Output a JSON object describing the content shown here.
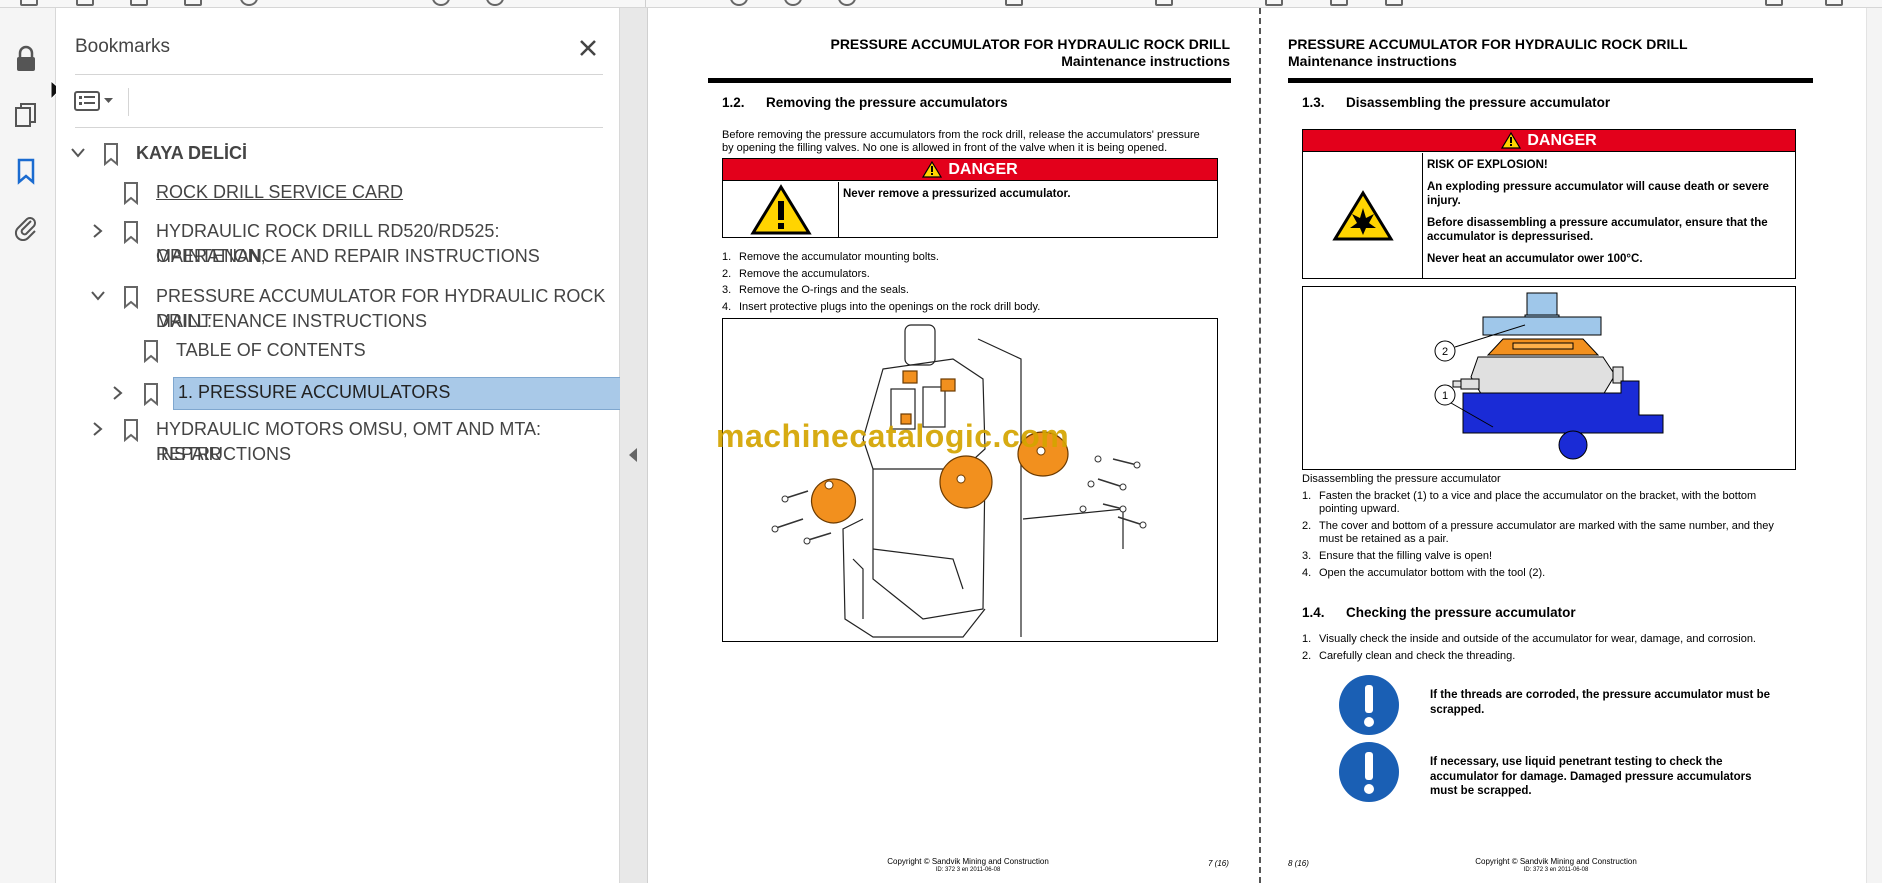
{
  "panel": {
    "title": "Bookmarks"
  },
  "bookmarks": [
    {
      "label": "KAYA DELİCİ",
      "level": 0,
      "expanded": true
    },
    {
      "label": "ROCK DRILL SERVICE CARD",
      "level": 1
    },
    {
      "label_line1": "HYDRAULIC ROCK DRILL RD520/RD525: OPERATION,",
      "label_line2": "MAINTENANCE AND REPAIR INSTRUCTIONS",
      "level": 1,
      "expanded": false
    },
    {
      "label_line1": "PRESSURE ACCUMULATOR FOR HYDRAULIC ROCK DRILL:",
      "label_line2": "MAINTENANCE INSTRUCTIONS",
      "level": 1,
      "expanded": true
    },
    {
      "label": "TABLE OF CONTENTS",
      "level": 2
    },
    {
      "label": "1. PRESSURE ACCUMULATORS",
      "level": 2,
      "selected": true,
      "expanded": false
    },
    {
      "label_line1": "HYDRAULIC MOTORS OMSU, OMT AND MTA: REPAIR",
      "label_line2": "INSTRUCTIONS",
      "level": 1,
      "expanded": false
    }
  ],
  "colors": {
    "selection": "#a9c9e8",
    "danger_red": "#e3001b",
    "accent_blue": "#1a6bd0",
    "note_blue": "#1a5fb4",
    "accumulator_orange": "#f2901e",
    "watermark": "#d4a400"
  },
  "watermark": "machinecatalogic.com",
  "page_left": {
    "header_line1": "PRESSURE ACCUMULATOR FOR HYDRAULIC ROCK DRILL",
    "header_line2": "Maintenance instructions",
    "section_num": "1.2.",
    "section_title": "Removing the pressure accumulators",
    "intro_line1": "Before removing the pressure accumulators from the rock drill, release the accumulators' pressure",
    "intro_line2": "by opening the filling valves. No one is allowed in front of the valve when it is being opened.",
    "danger_label": "DANGER",
    "danger_text": "Never remove a pressurized accumulator.",
    "steps": [
      "Remove the accumulator mounting bolts.",
      "Remove the accumulators.",
      "Remove the O-rings and the seals.",
      "Insert protective plugs into the openings on the rock drill body."
    ],
    "footer_line1": "Copyright © Sandvik Mining and Construction",
    "footer_line2": "ID: 372 3 en 2011-06-08",
    "page_number": "7 (16)"
  },
  "page_right": {
    "header_line1": "PRESSURE ACCUMULATOR FOR HYDRAULIC ROCK DRILL",
    "header_line2": "Maintenance instructions",
    "section_num": "1.3.",
    "section_title": "Disassembling the pressure accumulator",
    "danger_label": "DANGER",
    "danger_lines": [
      "RISK OF EXPLOSION!",
      "An exploding pressure accumulator will cause death or severe injury.",
      "Before disassembling a pressure accumulator, ensure that the accumulator is depressurised.",
      "Never heat an accumulator ower 100°C."
    ],
    "figure_callout_1": "1",
    "figure_callout_2": "2",
    "figure_caption": "Disassembling the pressure accumulator",
    "steps": [
      "Fasten the bracket (1) to a vice and place the accumulator on the bracket, with the bottom pointing upward.",
      "The cover and bottom of a pressure accumulator are marked with the same number, and they must be retained as a pair.",
      "Ensure that the filling valve is open!",
      "Open the accumulator bottom with the tool (2)."
    ],
    "section2_num": "1.4.",
    "section2_title": "Checking the pressure accumulator",
    "steps2": [
      "Visually check the inside and outside of the accumulator for wear, damage, and corrosion.",
      "Carefully clean and check the threading."
    ],
    "note1": "If the threads are corroded, the pressure accumulator must be scrapped.",
    "note2": "If necessary, use liquid penetrant testing to check the accumulator for damage. Damaged pressure accumulators must be scrapped.",
    "footer_line1": "Copyright © Sandvik Mining and Construction",
    "footer_line2": "ID: 372 3 en 2011-06-08",
    "page_number": "8 (16)"
  }
}
